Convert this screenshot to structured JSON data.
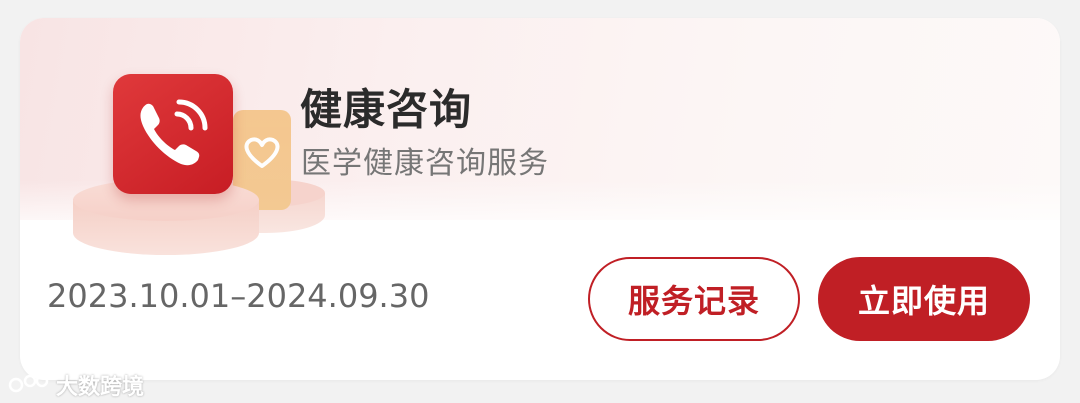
{
  "service": {
    "title": "健康咨询",
    "subtitle": "医学健康咨询服务",
    "validity": "2023.10.01–2024.09.30"
  },
  "actions": {
    "records_label": "服务记录",
    "use_label": "立即使用"
  },
  "illustration": {
    "main_icon": "phone-call-icon",
    "secondary_icon": "heart-icon"
  },
  "watermark": {
    "text": "大数跨境"
  },
  "colors": {
    "brand_red": "#c01f25",
    "tile_red": "#d6292e",
    "tile_orange": "#f4c58b",
    "title_text": "#2b2b2b",
    "muted_text": "#767676"
  }
}
